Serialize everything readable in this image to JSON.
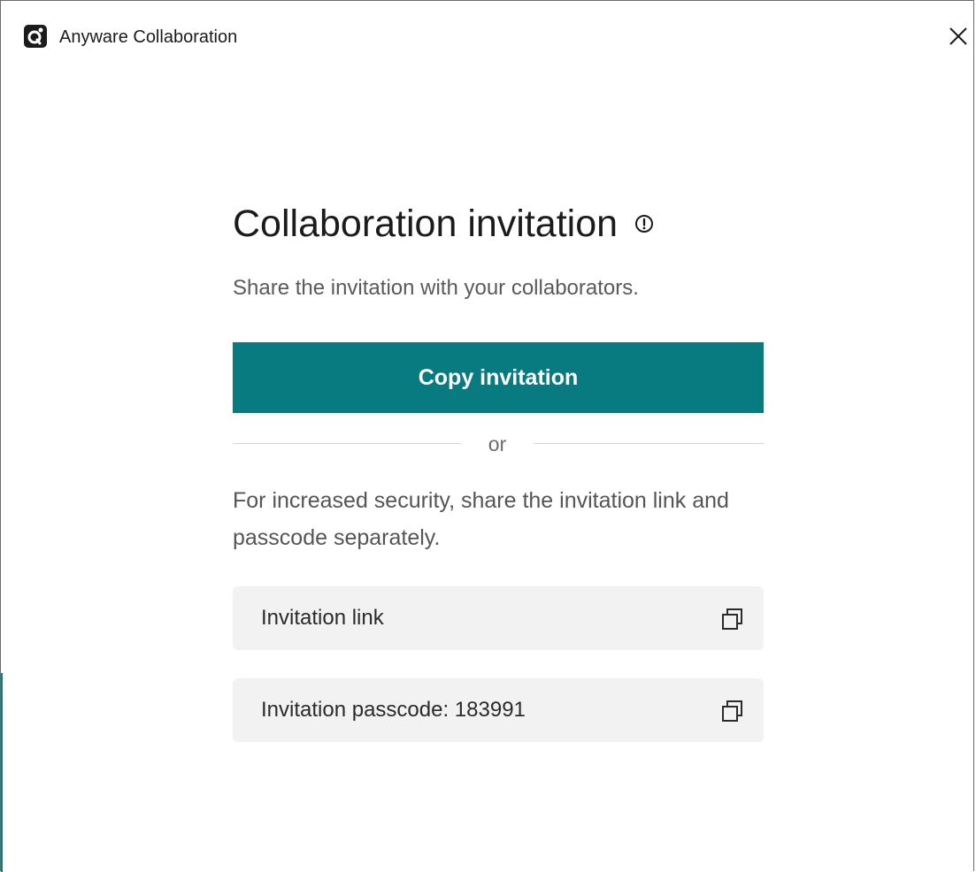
{
  "window": {
    "title": "Anyware Collaboration",
    "app_icon": "anyware-app-icon",
    "close_icon": "close-icon"
  },
  "dialog": {
    "heading": "Collaboration invitation",
    "info_icon": "info-icon",
    "subtitle": "Share the invitation with your collaborators.",
    "copy_invitation_label": "Copy invitation",
    "divider_text": "or",
    "security_text": "For increased security, share the invitation link and passcode separately.",
    "invitation_link_label": "Invitation link",
    "invitation_passcode_label": "Invitation passcode: 183991",
    "copy_icon": "copy-icon"
  },
  "colors": {
    "accent": "#077b80",
    "row_background": "#f2f2f2",
    "text_primary": "#1b1b1b",
    "text_secondary": "#555555"
  }
}
